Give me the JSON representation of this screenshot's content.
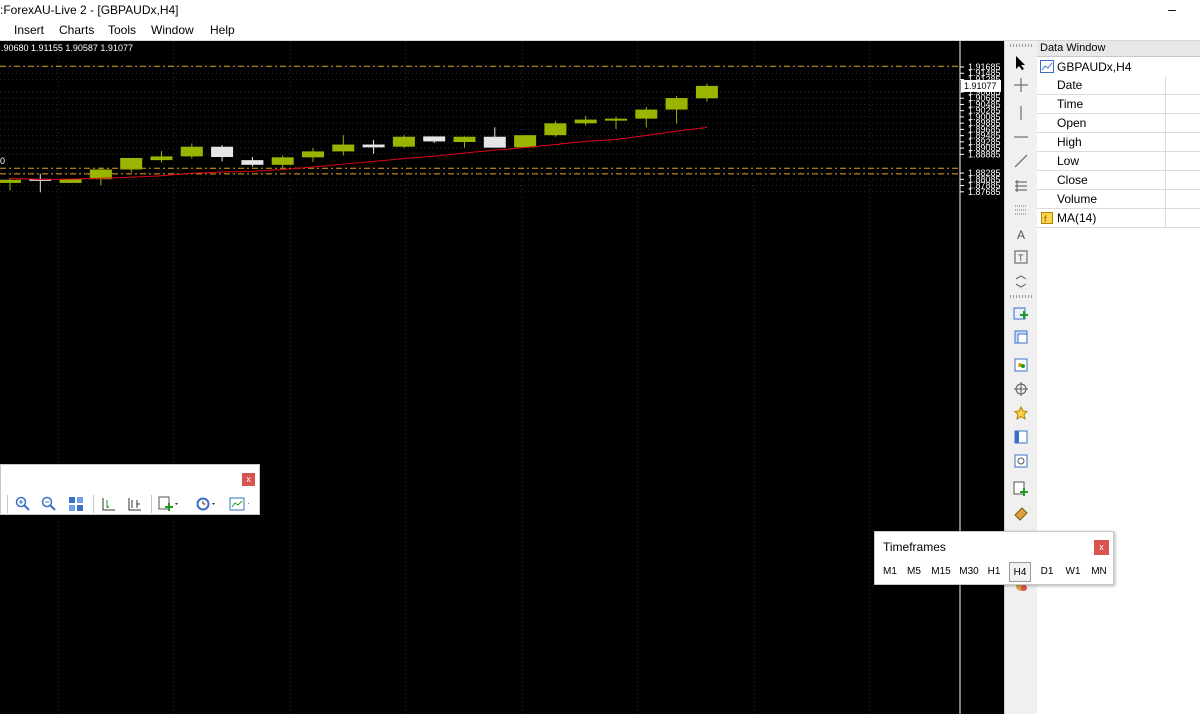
{
  "window": {
    "title": ":ForexAU-Live 2 - [GBPAUDx,H4]",
    "minimize": "–"
  },
  "menu": [
    {
      "label": "Insert"
    },
    {
      "label": "Charts"
    },
    {
      "label": "Tools"
    },
    {
      "label": "Window"
    },
    {
      "label": "Help"
    }
  ],
  "chart": {
    "ohlc_text": ".90680 1.91155 1.90587 1.91077",
    "price_labels": [
      "1.91685",
      "1.91485",
      "1.91285",
      "1.90885",
      "1.90685",
      "1.90485",
      "1.90285",
      "1.90085",
      "1.89885",
      "1.89685",
      "1.89485",
      "1.89285",
      "1.89085",
      "1.88885",
      "1.88285",
      "1.88085",
      "1.87885",
      "1.87685"
    ],
    "current_price": "1.91077",
    "left_edge_label": "0",
    "colors": {
      "background": "#000000",
      "grid": "#2b2b2b",
      "bull": "#9ab400",
      "bear": "#e6e6e6",
      "ma": "#e0001a",
      "level": "#e0a020"
    }
  },
  "chart_data": {
    "type": "candlestick",
    "ylim": [
      1.8765,
      1.9188
    ],
    "candles": [
      {
        "o": 1.8797,
        "h": 1.8812,
        "l": 1.8773,
        "c": 1.8807
      },
      {
        "o": 1.881,
        "h": 1.8826,
        "l": 1.8767,
        "c": 1.8806
      },
      {
        "o": 1.8797,
        "h": 1.8809,
        "l": 1.8797,
        "c": 1.8809
      },
      {
        "o": 1.8809,
        "h": 1.8846,
        "l": 1.8789,
        "c": 1.884
      },
      {
        "o": 1.884,
        "h": 1.8877,
        "l": 1.8831,
        "c": 1.8877
      },
      {
        "o": 1.887,
        "h": 1.8899,
        "l": 1.8862,
        "c": 1.8882
      },
      {
        "o": 1.8882,
        "h": 1.8923,
        "l": 1.8875,
        "c": 1.8913
      },
      {
        "o": 1.8913,
        "h": 1.8918,
        "l": 1.8866,
        "c": 1.888
      },
      {
        "o": 1.887,
        "h": 1.888,
        "l": 1.8849,
        "c": 1.8855
      },
      {
        "o": 1.8855,
        "h": 1.8885,
        "l": 1.8845,
        "c": 1.8879
      },
      {
        "o": 1.8879,
        "h": 1.8909,
        "l": 1.8865,
        "c": 1.8898
      },
      {
        "o": 1.8898,
        "h": 1.895,
        "l": 1.8885,
        "c": 1.892
      },
      {
        "o": 1.892,
        "h": 1.8935,
        "l": 1.889,
        "c": 1.8911
      },
      {
        "o": 1.8913,
        "h": 1.895,
        "l": 1.8909,
        "c": 1.8945
      },
      {
        "o": 1.8946,
        "h": 1.8946,
        "l": 1.8925,
        "c": 1.893
      },
      {
        "o": 1.8928,
        "h": 1.8946,
        "l": 1.891,
        "c": 1.8945
      },
      {
        "o": 1.8945,
        "h": 1.8975,
        "l": 1.891,
        "c": 1.891
      },
      {
        "o": 1.8911,
        "h": 1.895,
        "l": 1.891,
        "c": 1.895
      },
      {
        "o": 1.895,
        "h": 1.8995,
        "l": 1.8945,
        "c": 1.8988
      },
      {
        "o": 1.8988,
        "h": 1.9012,
        "l": 1.898,
        "c": 1.9
      },
      {
        "o": 1.9,
        "h": 1.901,
        "l": 1.897,
        "c": 1.9003
      },
      {
        "o": 1.9003,
        "h": 1.904,
        "l": 1.8975,
        "c": 1.9032
      },
      {
        "o": 1.9032,
        "h": 1.9075,
        "l": 1.8987,
        "c": 1.9069
      },
      {
        "o": 1.9068,
        "h": 1.9115,
        "l": 1.9058,
        "c": 1.9108
      }
    ],
    "ma": {
      "name": "MA(14)",
      "values": [
        1.8812,
        1.8808,
        1.8809,
        1.8812,
        1.8815,
        1.882,
        1.8828,
        1.8832,
        1.8834,
        1.884,
        1.8848,
        1.8857,
        1.8866,
        1.8875,
        1.8883,
        1.8893,
        1.8902,
        1.891,
        1.892,
        1.893,
        1.8936,
        1.8949,
        1.8963,
        1.8975
      ]
    },
    "levels": [
      1.9171,
      1.8844,
      1.8826
    ]
  },
  "data_window": {
    "title": "Data Window",
    "symbol": "GBPAUDx,H4",
    "rows": [
      "Date",
      "Time",
      "Open",
      "High",
      "Low",
      "Close",
      "Volume"
    ],
    "indicator": "MA(14)"
  },
  "chart_toolbar": {
    "close": "x"
  },
  "timeframes": {
    "title": "Timeframes",
    "close": "x",
    "items": [
      "M1",
      "M5",
      "M15",
      "M30",
      "H1",
      "H4",
      "D1",
      "W1",
      "MN"
    ],
    "active": "H4"
  }
}
